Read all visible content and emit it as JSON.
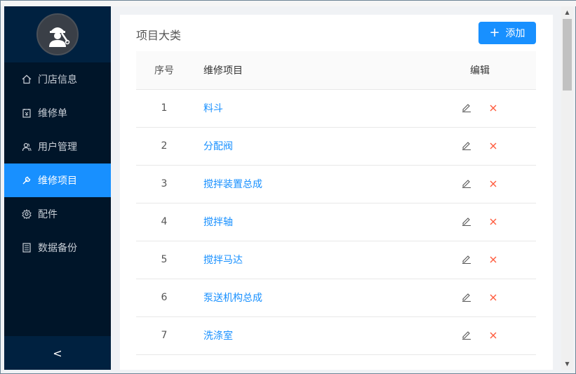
{
  "sidebar": {
    "items": [
      {
        "label": "门店信息",
        "icon": "home-icon",
        "active": false
      },
      {
        "label": "维修单",
        "icon": "order-icon",
        "active": false
      },
      {
        "label": "用户管理",
        "icon": "users-icon",
        "active": false
      },
      {
        "label": "维修项目",
        "icon": "wrench-icon",
        "active": true
      },
      {
        "label": "配件",
        "icon": "gear-icon",
        "active": false
      },
      {
        "label": "数据备份",
        "icon": "backup-icon",
        "active": false
      }
    ],
    "collapse_symbol": "<"
  },
  "main": {
    "title": "项目大类",
    "add_label": "添加",
    "table": {
      "headers": [
        "序号",
        "维修项目",
        "编辑"
      ],
      "rows": [
        {
          "idx": "1",
          "name": "料斗"
        },
        {
          "idx": "2",
          "name": "分配阀"
        },
        {
          "idx": "3",
          "name": "搅拌装置总成"
        },
        {
          "idx": "4",
          "name": "搅拌轴"
        },
        {
          "idx": "5",
          "name": "搅拌马达"
        },
        {
          "idx": "6",
          "name": "泵送机构总成"
        },
        {
          "idx": "7",
          "name": "洗涤室"
        }
      ]
    }
  },
  "colors": {
    "accent": "#1890ff",
    "sidebar": "#001529",
    "delete": "#ff5a3c"
  }
}
